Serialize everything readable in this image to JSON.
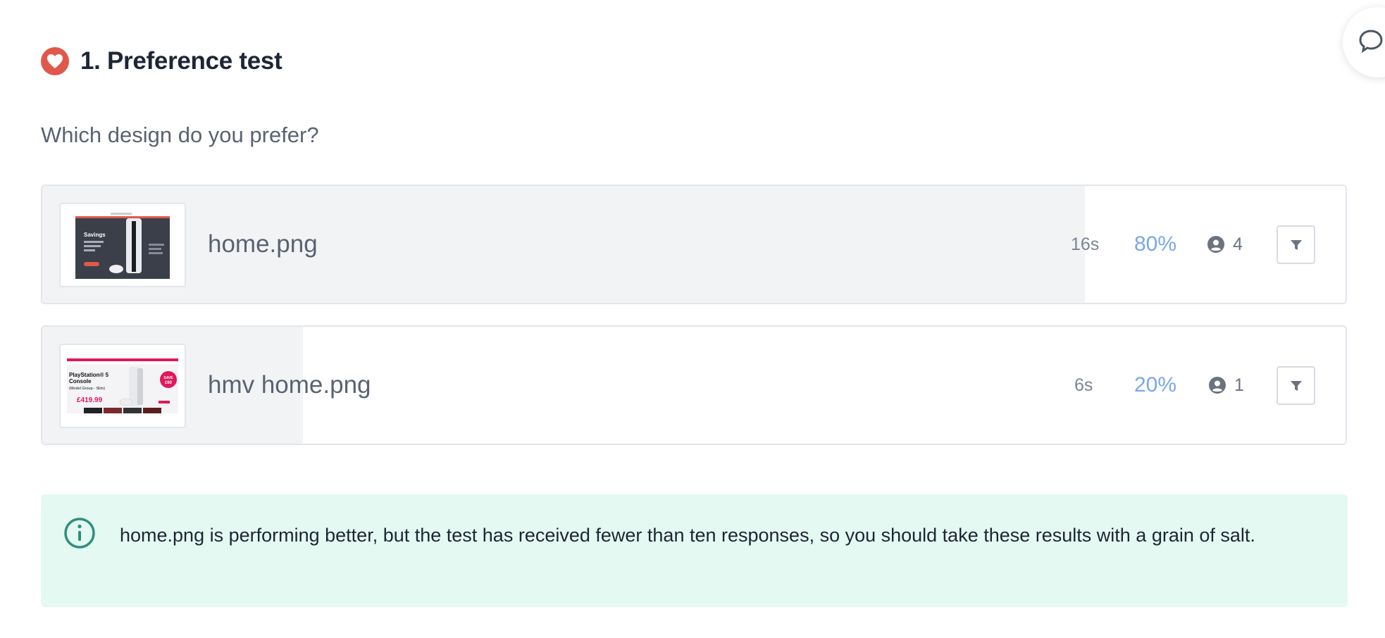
{
  "section": {
    "title": "1. Preference test",
    "question": "Which design do you prefer?"
  },
  "options": [
    {
      "name": "home.png",
      "time": "16s",
      "percent": "80%",
      "percent_value": 80,
      "responses": "4",
      "thumb_label": "Savings"
    },
    {
      "name": "hmv home.png",
      "time": "6s",
      "percent": "20%",
      "percent_value": 20,
      "responses": "1",
      "thumb_label": "PlayStation® 5 Console",
      "thumb_sub": "(Model Group - Slim)",
      "thumb_price": "£419.99",
      "thumb_badge": "SAVE £60"
    }
  ],
  "info": {
    "message": "home.png is performing better, but the test has received fewer than ten responses, so you should take these results with a grain of salt."
  },
  "colors": {
    "heart_badge": "#e0584c",
    "percent": "#7aa7e8",
    "info_bg": "#e4f9f1",
    "info_icon": "#2f8f7f"
  }
}
